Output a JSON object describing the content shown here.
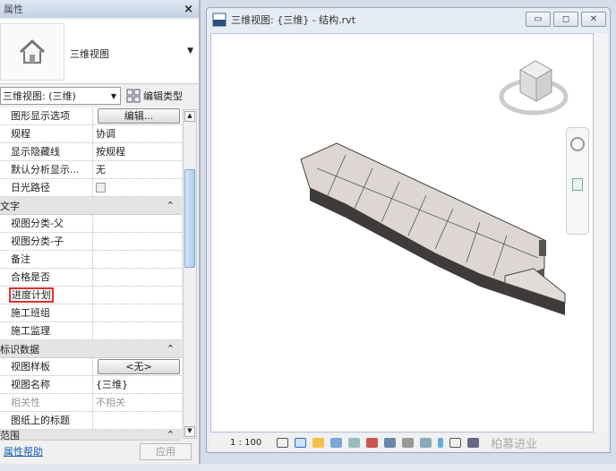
{
  "properties": {
    "title": "属性",
    "close": "×",
    "preview_name": "三维视图",
    "type_selector": "三维视图: (三维)",
    "edit_type": "编辑类型",
    "rows_graphics": [
      {
        "k": "图形显示选项",
        "v": "编辑..."
      },
      {
        "k": "规程",
        "v": "协调"
      },
      {
        "k": "显示隐藏线",
        "v": "按规程"
      },
      {
        "k": "默认分析显示...",
        "v": "无"
      },
      {
        "k": "日光路径",
        "v": ""
      }
    ],
    "section_text": "文字",
    "rows_text": [
      {
        "k": "视图分类-父",
        "v": ""
      },
      {
        "k": "视图分类-子",
        "v": ""
      },
      {
        "k": "备注",
        "v": ""
      },
      {
        "k": "合格是否",
        "v": ""
      },
      {
        "k": "进度计划",
        "v": ""
      },
      {
        "k": "施工班组",
        "v": ""
      },
      {
        "k": "施工监理",
        "v": ""
      }
    ],
    "section_identity": "标识数据",
    "rows_identity": [
      {
        "k": "视图样板",
        "v": "<无>"
      },
      {
        "k": "视图名称",
        "v": "{三维}"
      },
      {
        "k": "相关性",
        "v": "不相关"
      },
      {
        "k": "图纸上的标题",
        "v": ""
      }
    ],
    "section_extents": "范围",
    "help_link": "属性帮助",
    "apply": "应用"
  },
  "view_window": {
    "title": "三维视图: {三维} - 结构.rvt",
    "scale": "1 : 100",
    "watermark": "柏慕进业"
  }
}
